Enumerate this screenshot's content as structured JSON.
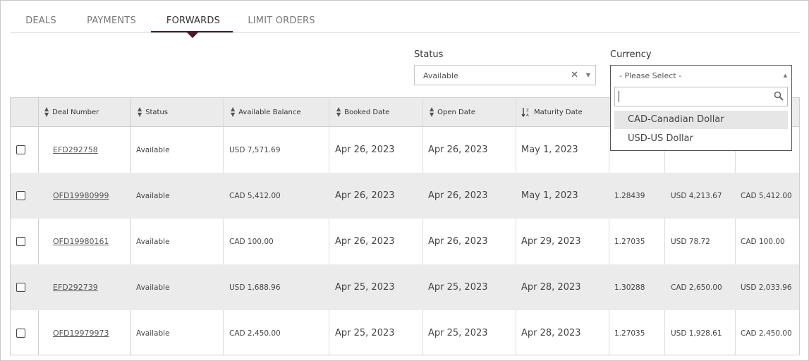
{
  "tabs": [
    {
      "label": "DEALS"
    },
    {
      "label": "PAYMENTS"
    },
    {
      "label": "FORWARDS"
    },
    {
      "label": "LIMIT ORDERS"
    }
  ],
  "active_tab": "FORWARDS",
  "filters": {
    "status_label": "Status",
    "status_value": "Available",
    "currency_label": "Currency",
    "currency_value": "- Please Select -",
    "currency_search": "",
    "currency_options": [
      "CAD-Canadian Dollar",
      "USD-US Dollar"
    ]
  },
  "table": {
    "columns": [
      "Deal Number",
      "Status",
      "Available Balance",
      "Booked Date",
      "Open Date",
      "Maturity Date"
    ],
    "rows": [
      {
        "deal": "EFD292758",
        "status": "Available",
        "balance": "USD 7,571.69",
        "booked": "Apr 26, 2023",
        "open": "Apr 26, 2023",
        "maturity": "May 1, 2023",
        "rate": "",
        "amt1": "",
        "amt2": ""
      },
      {
        "deal": "OFD19980999",
        "status": "Available",
        "balance": "CAD 5,412.00",
        "booked": "Apr 26, 2023",
        "open": "Apr 26, 2023",
        "maturity": "May 1, 2023",
        "rate": "1.28439",
        "amt1": "USD 4,213.67",
        "amt2": "CAD 5,412.00"
      },
      {
        "deal": "OFD19980161",
        "status": "Available",
        "balance": "CAD 100.00",
        "booked": "Apr 26, 2023",
        "open": "Apr 26, 2023",
        "maturity": "Apr 29, 2023",
        "rate": "1.27035",
        "amt1": "USD 78.72",
        "amt2": "CAD 100.00"
      },
      {
        "deal": "EFD292739",
        "status": "Available",
        "balance": "USD 1,688.96",
        "booked": "Apr 25, 2023",
        "open": "Apr 25, 2023",
        "maturity": "Apr 28, 2023",
        "rate": "1.30288",
        "amt1": "CAD 2,650.00",
        "amt2": "USD 2,033.96"
      },
      {
        "deal": "OFD19979973",
        "status": "Available",
        "balance": "CAD 2,450.00",
        "booked": "Apr 25, 2023",
        "open": "Apr 25, 2023",
        "maturity": "Apr 28, 2023",
        "rate": "1.27035",
        "amt1": "USD 1,928.61",
        "amt2": "CAD 2,450.00"
      }
    ]
  },
  "icons": {
    "sort": "sort-updown-icon",
    "sort_za": "sort-za-icon",
    "clear": "clear-x-icon",
    "search": "search-icon"
  }
}
